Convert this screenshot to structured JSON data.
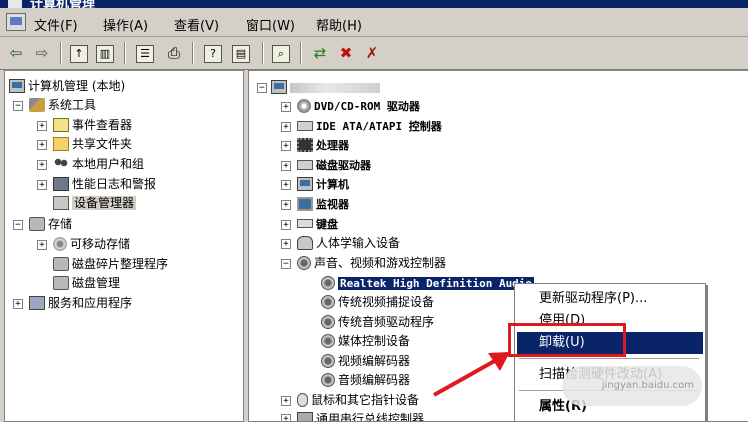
{
  "window": {
    "title": "计算机管理"
  },
  "menubar": {
    "items": [
      "文件(F)",
      "操作(A)",
      "查看(V)",
      "窗口(W)",
      "帮助(H)"
    ]
  },
  "toolbar": {
    "buttons": [
      "back-icon",
      "forward-icon",
      "up-folder-icon",
      "show-hide-tree-icon",
      "properties-icon",
      "print-icon",
      "help-icon",
      "view-icon",
      "scan-hardware-icon",
      "update-driver-icon",
      "disable-icon",
      "uninstall-icon"
    ]
  },
  "left_tree": {
    "root": "计算机管理 (本地)",
    "system_tools": "系统工具",
    "event_viewer": "事件查看器",
    "shared_folders": "共享文件夹",
    "local_users": "本地用户和组",
    "perf_logs": "性能日志和警报",
    "device_manager": "设备管理器",
    "storage": "存储",
    "removable": "可移动存储",
    "defrag": "磁盘碎片整理程序",
    "disk_mgmt": "磁盘管理",
    "services": "服务和应用程序"
  },
  "right_tree": {
    "dvd": "DVD/CD-ROM 驱动器",
    "ide": "IDE ATA/ATAPI 控制器",
    "cpu": "处理器",
    "disk_drives": "磁盘驱动器",
    "computer": "计算机",
    "monitor": "监视器",
    "keyboard": "键盘",
    "hid": "人体学输入设备",
    "sound": "声音、视频和游戏控制器",
    "realtek": "Realtek High Definition Audio",
    "legacy_video": "传统视频捕捉设备",
    "legacy_audio": "传统音频驱动程序",
    "media_control": "媒体控制设备",
    "video_codec": "视频编解码器",
    "audio_codec": "音频编解码器",
    "mouse": "鼠标和其它指针设备",
    "usb": "通用串行总线控制器"
  },
  "context_menu": {
    "update_driver": "更新驱动程序(P)...",
    "disable": "停用(D)",
    "uninstall": "卸载(U)",
    "scan": "扫描检测硬件改动(A)",
    "properties": "属性(R)"
  },
  "watermark": "jingyan.baidu.com",
  "colors": {
    "selection": "#0a246a",
    "highlight_box": "#e0191f",
    "background": "#d4d0c8"
  }
}
